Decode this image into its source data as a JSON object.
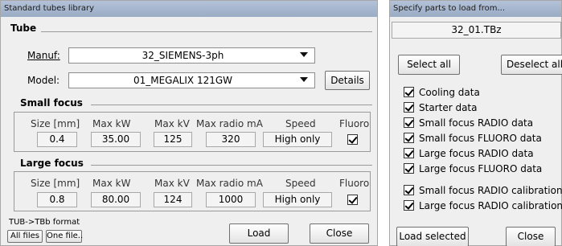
{
  "left_window": {
    "title": "Standard tubes library",
    "tube_group": {
      "title": "Tube",
      "manuf_label": "Manuf:",
      "manuf_value": "32_SIEMENS-3ph",
      "model_label": "Model:",
      "model_value": "01_MEGALIX 121GW",
      "details_button": "Details"
    },
    "small_focus": {
      "title": "Small focus",
      "headers": [
        "Size [mm]",
        "Max kW",
        "Max kV",
        "Max radio mA",
        "Speed",
        "Fluoro"
      ],
      "values": {
        "size": "0.4",
        "max_kw": "35.00",
        "max_kv": "125",
        "max_ma": "320",
        "speed": "High only"
      },
      "fluoro_checked": true
    },
    "large_focus": {
      "title": "Large focus",
      "headers": [
        "Size [mm]",
        "Max kW",
        "Max kV",
        "Max radio mA",
        "Speed",
        "Fluoro"
      ],
      "values": {
        "size": "0.8",
        "max_kw": "80.00",
        "max_kv": "124",
        "max_ma": "1000",
        "speed": "High only"
      },
      "fluoro_checked": true
    },
    "footer": {
      "format_label": "TUB->TBb format",
      "all_files": "All files",
      "one_file": "One file..",
      "load": "Load",
      "close": "Close"
    }
  },
  "right_window": {
    "title": "Specify parts to load from...",
    "filename": "32_01.TBz",
    "select_all": "Select all",
    "deselect_all": "Deselect all",
    "parts": [
      {
        "label": "Cooling data",
        "checked": true
      },
      {
        "label": "Starter data",
        "checked": true
      },
      {
        "label": "Small focus RADIO data",
        "checked": true
      },
      {
        "label": "Small focus FLUORO data",
        "checked": true
      },
      {
        "label": "Large focus RADIO data",
        "checked": true
      },
      {
        "label": "Large focus FLUORO data",
        "checked": true
      },
      {
        "label": "Small focus RADIO calibration",
        "checked": true
      },
      {
        "label": "Large focus RADIO calibration",
        "checked": true
      }
    ],
    "load_selected": "Load selected",
    "close": "Close"
  }
}
